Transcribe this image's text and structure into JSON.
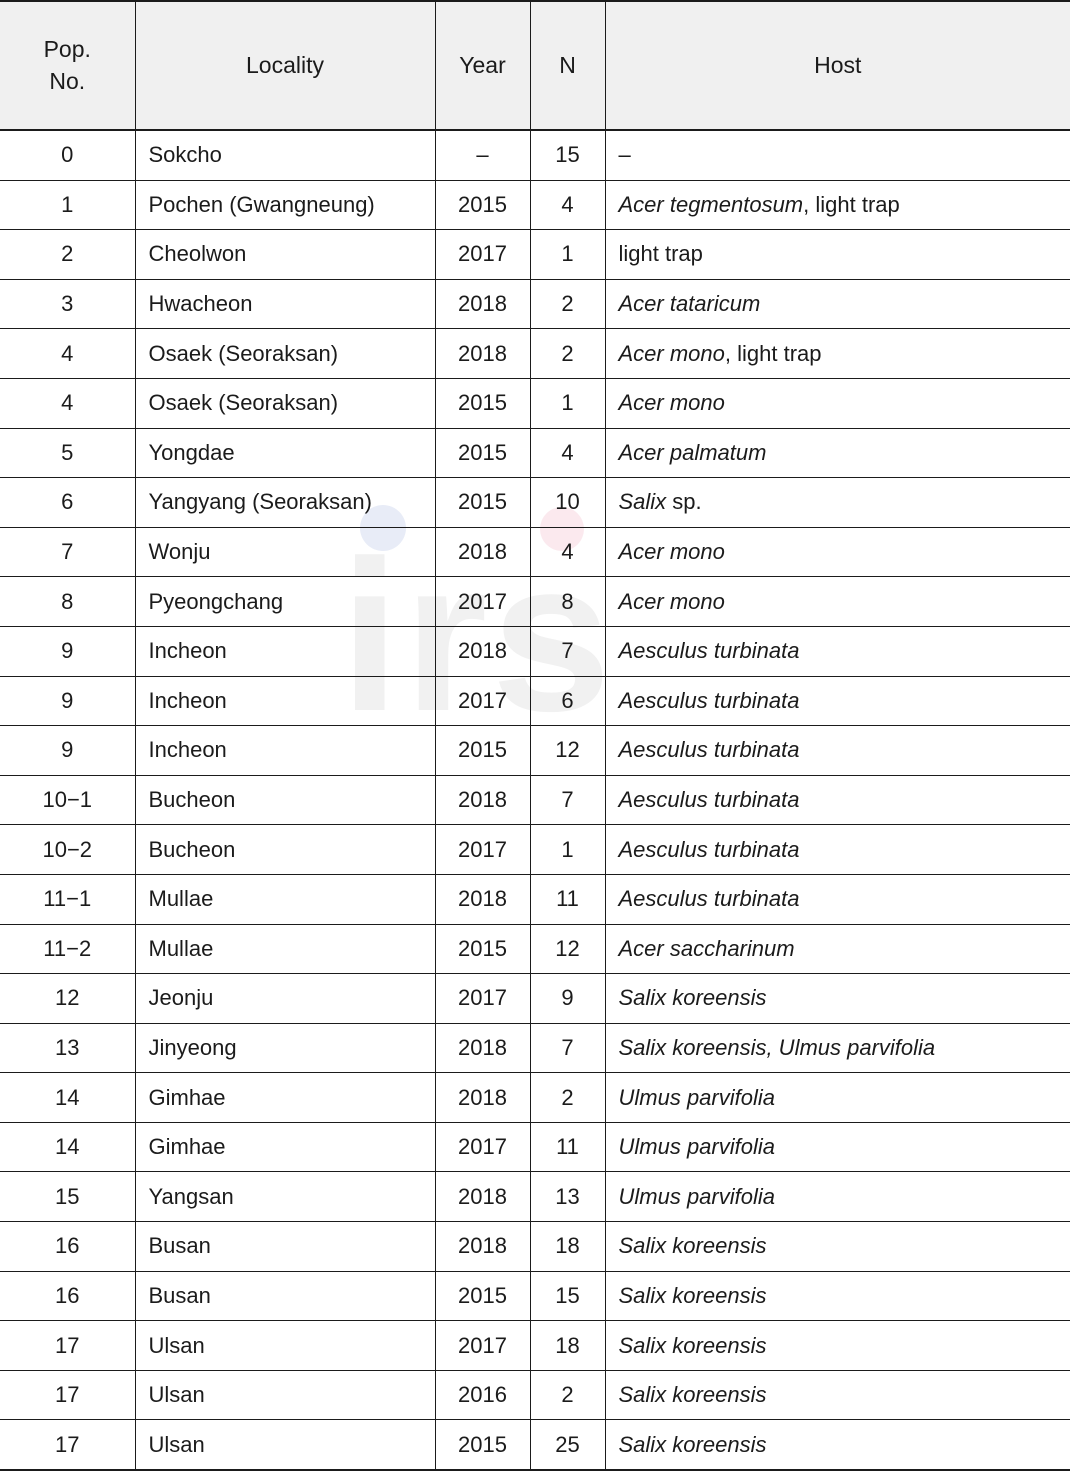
{
  "table": {
    "columns": [
      {
        "key": "pop",
        "label": "Pop.\nNo.",
        "label_line1": "Pop.",
        "label_line2": "No."
      },
      {
        "key": "loc",
        "label": "Locality"
      },
      {
        "key": "year",
        "label": "Year"
      },
      {
        "key": "n",
        "label": "N"
      },
      {
        "key": "host",
        "label": "Host"
      }
    ],
    "header": {
      "pop_line1": "Pop.",
      "pop_line2": "No.",
      "locality": "Locality",
      "year": "Year",
      "n": "N",
      "host": "Host"
    },
    "rows": [
      {
        "pop": "0",
        "locality": "Sokcho",
        "year": "–",
        "n": "15",
        "host_parts": [
          {
            "text": "–",
            "italic": false
          }
        ]
      },
      {
        "pop": "1",
        "locality": "Pochen (Gwangneung)",
        "year": "2015",
        "n": "4",
        "host_parts": [
          {
            "text": "Acer tegmentosum",
            "italic": true
          },
          {
            "text": ", light trap",
            "italic": false
          }
        ]
      },
      {
        "pop": "2",
        "locality": "Cheolwon",
        "year": "2017",
        "n": "1",
        "host_parts": [
          {
            "text": "light trap",
            "italic": false
          }
        ]
      },
      {
        "pop": "3",
        "locality": "Hwacheon",
        "year": "2018",
        "n": "2",
        "host_parts": [
          {
            "text": "Acer tataricum",
            "italic": true
          }
        ]
      },
      {
        "pop": "4",
        "locality": "Osaek (Seoraksan)",
        "year": "2018",
        "n": "2",
        "host_parts": [
          {
            "text": "Acer mono",
            "italic": true
          },
          {
            "text": ", light trap",
            "italic": false
          }
        ]
      },
      {
        "pop": "4",
        "locality": "Osaek (Seoraksan)",
        "year": "2015",
        "n": "1",
        "host_parts": [
          {
            "text": "Acer mono",
            "italic": true
          }
        ]
      },
      {
        "pop": "5",
        "locality": "Yongdae",
        "year": "2015",
        "n": "4",
        "host_parts": [
          {
            "text": "Acer palmatum",
            "italic": true
          }
        ]
      },
      {
        "pop": "6",
        "locality": "Yangyang (Seoraksan)",
        "year": "2015",
        "n": "10",
        "host_parts": [
          {
            "text": "Salix",
            "italic": true
          },
          {
            "text": " sp.",
            "italic": false
          }
        ]
      },
      {
        "pop": "7",
        "locality": "Wonju",
        "year": "2018",
        "n": "4",
        "host_parts": [
          {
            "text": "Acer mono",
            "italic": true
          }
        ]
      },
      {
        "pop": "8",
        "locality": "Pyeongchang",
        "year": "2017",
        "n": "8",
        "host_parts": [
          {
            "text": "Acer mono",
            "italic": true
          }
        ]
      },
      {
        "pop": "9",
        "locality": "Incheon",
        "year": "2018",
        "n": "7",
        "host_parts": [
          {
            "text": "Aesculus turbinata",
            "italic": true
          }
        ]
      },
      {
        "pop": "9",
        "locality": "Incheon",
        "year": "2017",
        "n": "6",
        "host_parts": [
          {
            "text": "Aesculus turbinata",
            "italic": true
          }
        ]
      },
      {
        "pop": "9",
        "locality": "Incheon",
        "year": "2015",
        "n": "12",
        "host_parts": [
          {
            "text": "Aesculus turbinata",
            "italic": true
          }
        ]
      },
      {
        "pop": "10−1",
        "locality": "Bucheon",
        "year": "2018",
        "n": "7",
        "host_parts": [
          {
            "text": "Aesculus turbinata",
            "italic": true
          }
        ]
      },
      {
        "pop": "10−2",
        "locality": "Bucheon",
        "year": "2017",
        "n": "1",
        "host_parts": [
          {
            "text": "Aesculus turbinata",
            "italic": true
          }
        ]
      },
      {
        "pop": "11−1",
        "locality": "Mullae",
        "year": "2018",
        "n": "11",
        "host_parts": [
          {
            "text": "Aesculus turbinata",
            "italic": true
          }
        ]
      },
      {
        "pop": "11−2",
        "locality": "Mullae",
        "year": "2015",
        "n": "12",
        "host_parts": [
          {
            "text": "Acer saccharinum",
            "italic": true
          }
        ]
      },
      {
        "pop": "12",
        "locality": "Jeonju",
        "year": "2017",
        "n": "9",
        "host_parts": [
          {
            "text": "Salix koreensis",
            "italic": true
          }
        ]
      },
      {
        "pop": "13",
        "locality": "Jinyeong",
        "year": "2018",
        "n": "7",
        "host_parts": [
          {
            "text": "Salix koreensis, Ulmus parvifolia",
            "italic": true
          }
        ]
      },
      {
        "pop": "14",
        "locality": "Gimhae",
        "year": "2018",
        "n": "2",
        "host_parts": [
          {
            "text": "Ulmus parvifolia",
            "italic": true
          }
        ]
      },
      {
        "pop": "14",
        "locality": "Gimhae",
        "year": "2017",
        "n": "11",
        "host_parts": [
          {
            "text": "Ulmus parvifolia",
            "italic": true
          }
        ]
      },
      {
        "pop": "15",
        "locality": "Yangsan",
        "year": "2018",
        "n": "13",
        "host_parts": [
          {
            "text": "Ulmus parvifolia",
            "italic": true
          }
        ]
      },
      {
        "pop": "16",
        "locality": "Busan",
        "year": "2018",
        "n": "18",
        "host_parts": [
          {
            "text": "Salix koreensis",
            "italic": true
          }
        ]
      },
      {
        "pop": "16",
        "locality": "Busan",
        "year": "2015",
        "n": "15",
        "host_parts": [
          {
            "text": "Salix koreensis",
            "italic": true
          }
        ]
      },
      {
        "pop": "17",
        "locality": "Ulsan",
        "year": "2017",
        "n": "18",
        "host_parts": [
          {
            "text": "Salix koreensis",
            "italic": true
          }
        ]
      },
      {
        "pop": "17",
        "locality": "Ulsan",
        "year": "2016",
        "n": "2",
        "host_parts": [
          {
            "text": "Salix koreensis",
            "italic": true
          }
        ]
      },
      {
        "pop": "17",
        "locality": "Ulsan",
        "year": "2015",
        "n": "25",
        "host_parts": [
          {
            "text": "Salix koreensis",
            "italic": true
          }
        ]
      }
    ]
  },
  "watermark": {
    "text": "irs",
    "color": "#f1f1f1",
    "dot_blue": "#e8ecf7",
    "dot_pink": "#fbe9ee"
  },
  "colors": {
    "header_background": "#f0f0f0",
    "border": "#1b1b1b",
    "text": "#1b1b1b",
    "page_background": "#ffffff"
  }
}
